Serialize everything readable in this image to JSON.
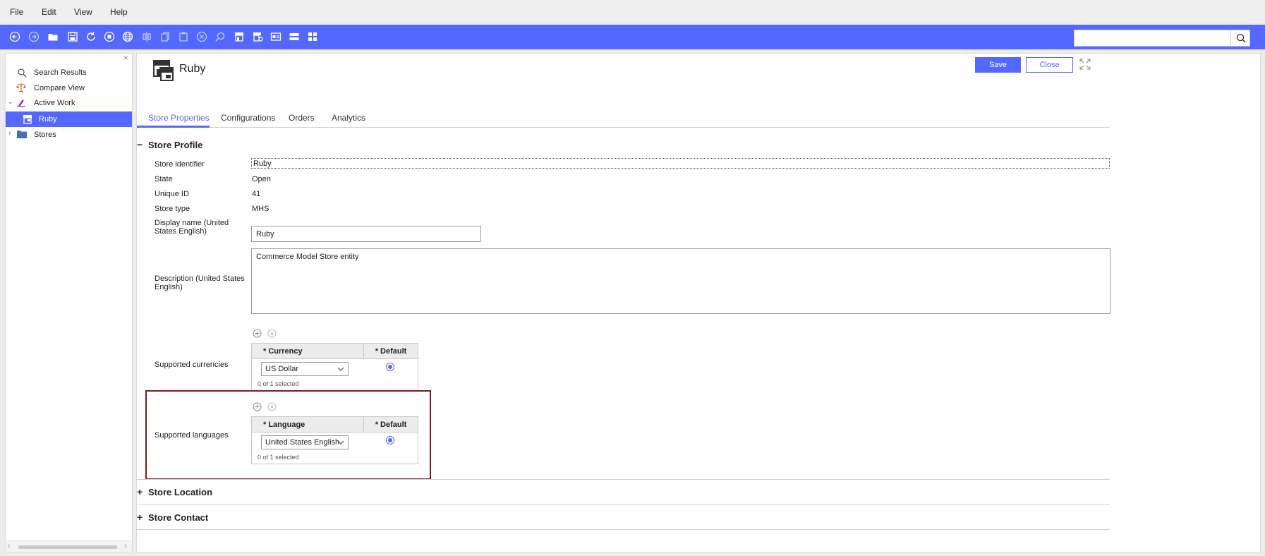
{
  "menubar": {
    "file": "File",
    "edit": "Edit",
    "view": "View",
    "help": "Help"
  },
  "toolbar": {
    "icons": [
      "back-icon",
      "forward-icon",
      "open-folder-icon",
      "save-icon",
      "refresh-icon",
      "stop-icon",
      "globe-icon",
      "split-icon",
      "copy-icon",
      "paste-icon",
      "delete-icon",
      "find-icon",
      "store-icon",
      "store-settings-icon",
      "image-icon",
      "layout-icon",
      "grid-icon"
    ],
    "search_placeholder": "",
    "search_value": ""
  },
  "navigator": {
    "items": [
      {
        "label": "Search Results",
        "icon": "search-icon"
      },
      {
        "label": "Compare View",
        "icon": "compare-icon"
      },
      {
        "label": "Active Work",
        "icon": "active-work-icon"
      },
      {
        "label": "Ruby",
        "icon": "store-icon"
      },
      {
        "label": "Stores",
        "icon": "folder-icon"
      }
    ]
  },
  "editor": {
    "title": "Ruby",
    "save_label": "Save",
    "close_label": "Close",
    "tabs": [
      "Store Properties",
      "Configurations",
      "Orders",
      "Analytics"
    ],
    "active_tab": "Store Properties"
  },
  "store_profile": {
    "title": "Store Profile",
    "fields": {
      "store_identifier": {
        "label": "Store identifier",
        "value": "Ruby"
      },
      "state": {
        "label": "State",
        "value": "Open"
      },
      "unique_id": {
        "label": "Unique ID",
        "value": "41"
      },
      "store_type": {
        "label": "Store type",
        "value": "MHS"
      },
      "display_name": {
        "label": "Display name (United States English)",
        "value": "Ruby"
      },
      "description": {
        "label": "Description (United States English)",
        "value": "Commerce Model Store entity"
      }
    },
    "currencies": {
      "label": "Supported currencies",
      "column_currency": "* Currency",
      "column_default": "* Default",
      "selected_value": "US Dollar",
      "selection_count": "0 of 1 selected"
    },
    "languages": {
      "label": "Supported languages",
      "column_language": "* Language",
      "column_default": "* Default",
      "selected_value": "United States English",
      "selection_count": "0 of 1 selected"
    }
  },
  "collapsed_sections": {
    "store_location": "Store Location",
    "store_contact": "Store Contact"
  },
  "colors": {
    "accent": "#5468ff",
    "highlight_box": "#7a1c1c"
  }
}
